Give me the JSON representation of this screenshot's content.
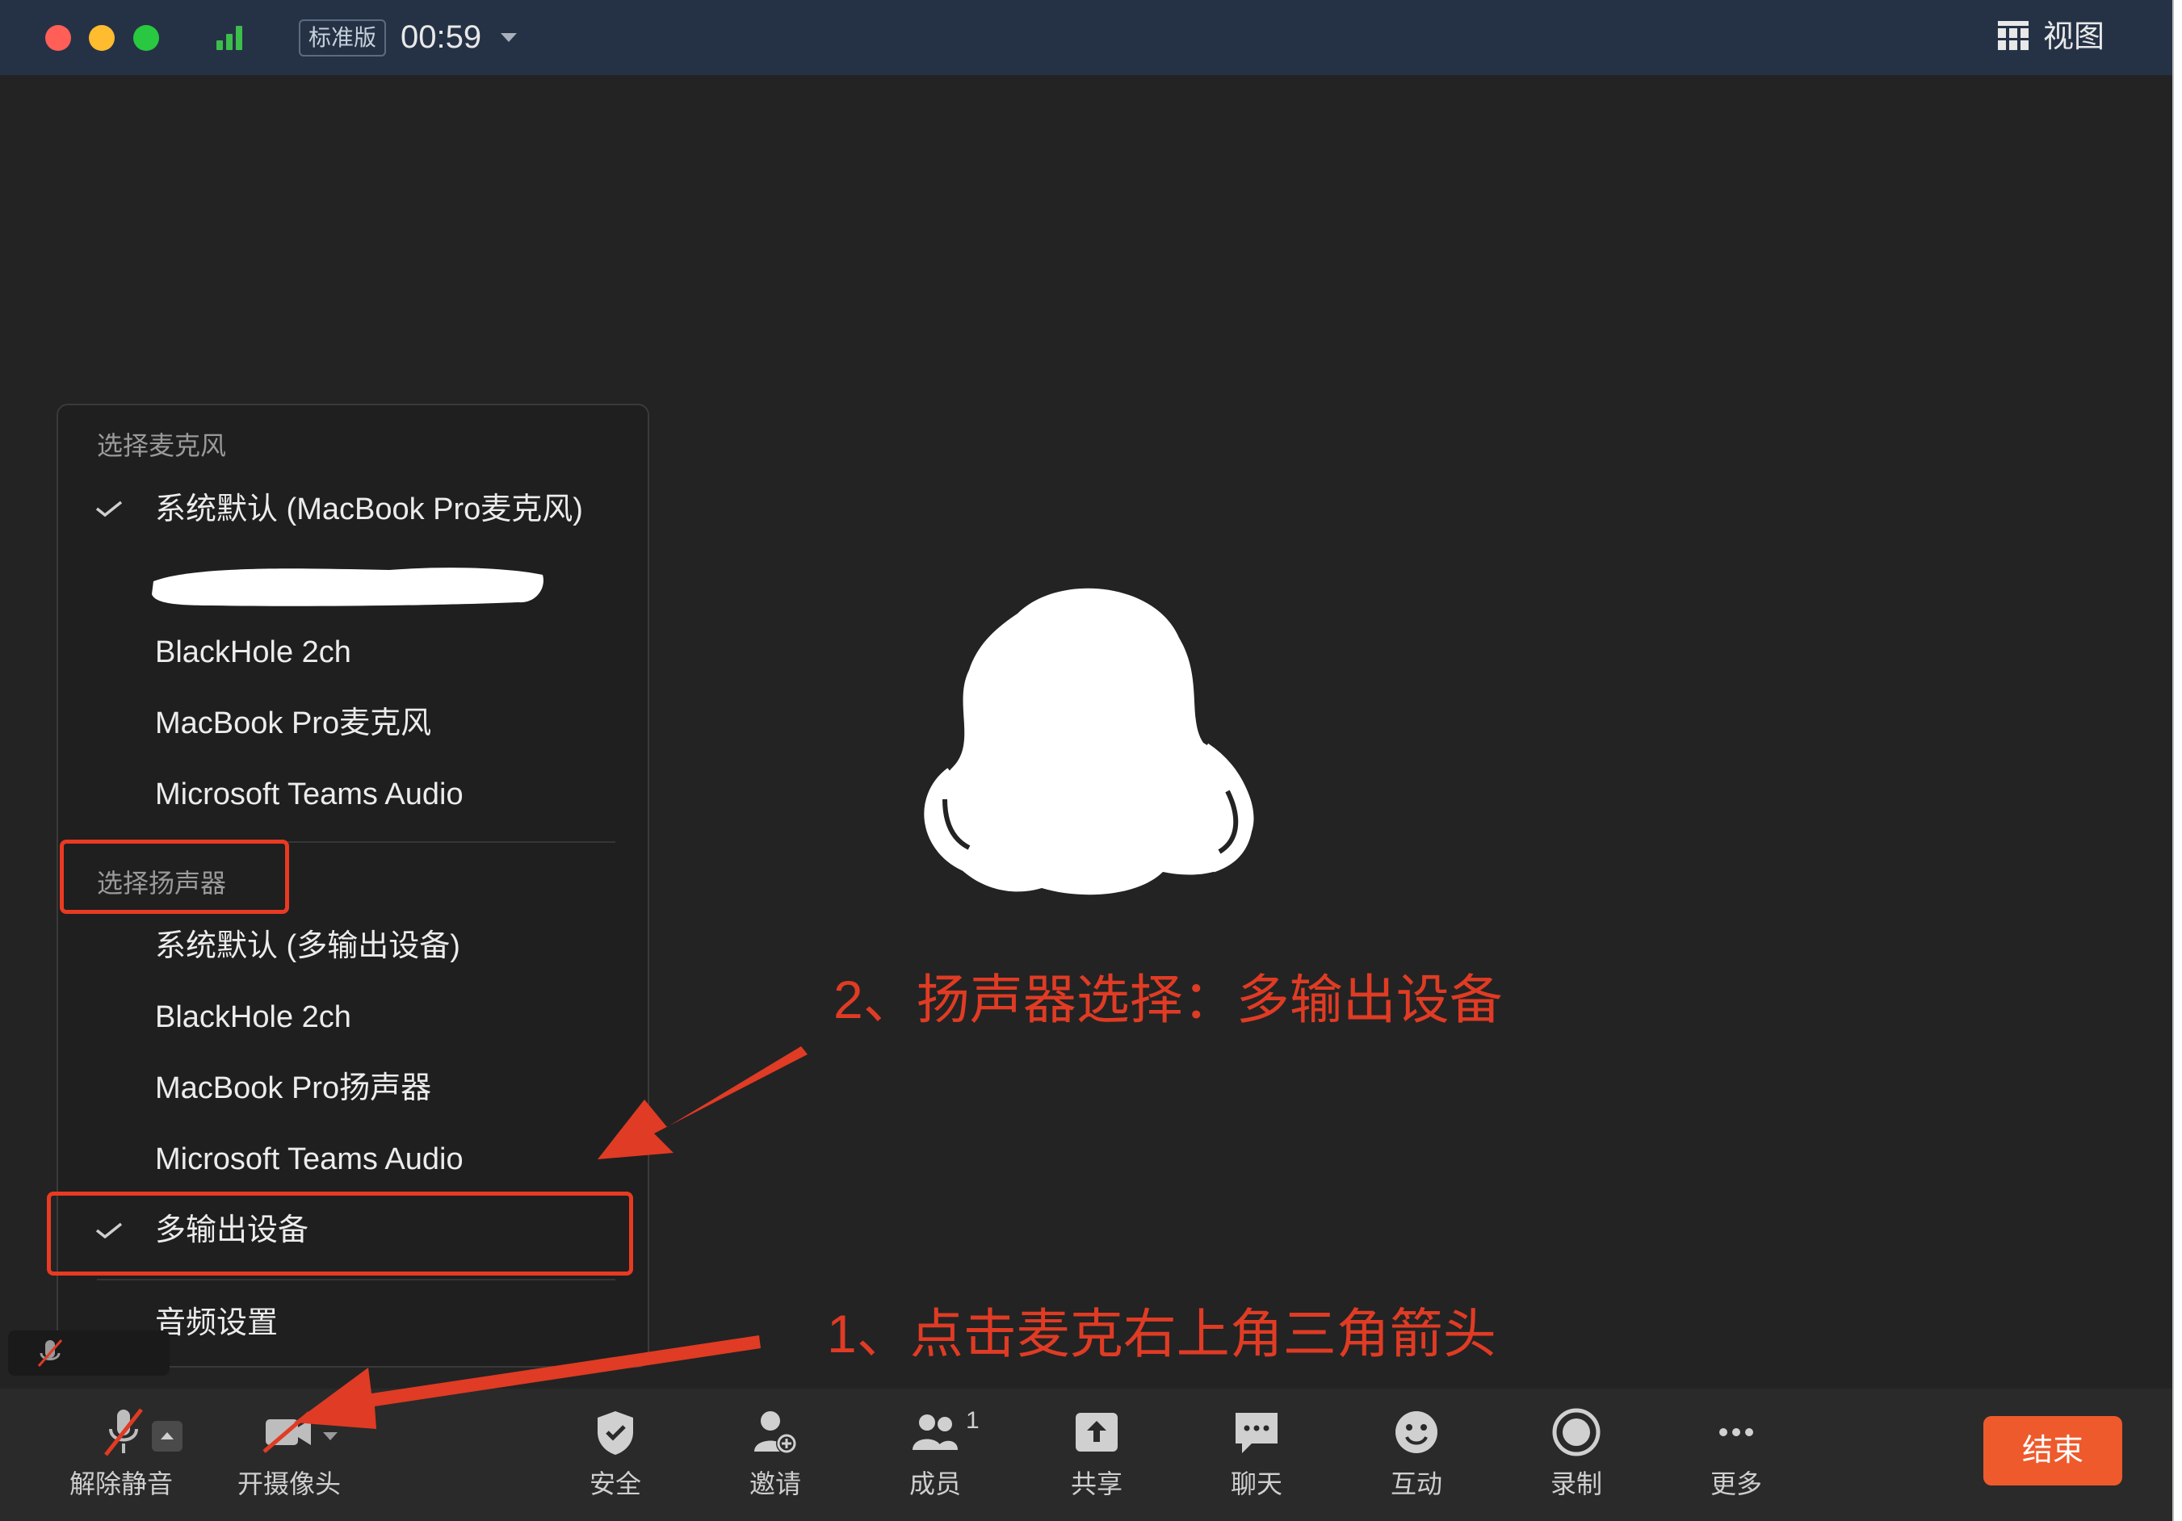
{
  "titlebar": {
    "edition_badge": "标准版",
    "timer": "00:59",
    "view_label": "视图"
  },
  "menu": {
    "mic_header": "选择麦克风",
    "mic_items": [
      {
        "label": "系统默认 (MacBook Pro麦克风)",
        "checked": true
      },
      {
        "label": "",
        "redacted": true
      },
      {
        "label": "BlackHole 2ch",
        "checked": false
      },
      {
        "label": "MacBook Pro麦克风",
        "checked": false
      },
      {
        "label": "Microsoft Teams Audio",
        "checked": false
      }
    ],
    "speaker_header": "选择扬声器",
    "speaker_items": [
      {
        "label": "系统默认 (多输出设备)",
        "checked": false
      },
      {
        "label": "BlackHole 2ch",
        "checked": false
      },
      {
        "label": "MacBook Pro扬声器",
        "checked": false
      },
      {
        "label": "Microsoft Teams Audio",
        "checked": false
      },
      {
        "label": "多输出设备",
        "checked": true
      }
    ],
    "audio_settings": "音频设置"
  },
  "annotations": {
    "step2": "2、扬声器选择：多输出设备",
    "step1": "1、点击麦克右上角三角箭头"
  },
  "toolbar": {
    "unmute": "解除静音",
    "start_video": "开摄像头",
    "security": "安全",
    "invite": "邀请",
    "participants": "成员",
    "participants_count": "1",
    "share": "共享",
    "chat": "聊天",
    "reactions": "互动",
    "record": "录制",
    "more": "更多",
    "end": "结束"
  },
  "colors": {
    "accent_end": "#ee5a2b",
    "annotation_red": "#e03b24",
    "signal_green": "#3dbd4c"
  }
}
